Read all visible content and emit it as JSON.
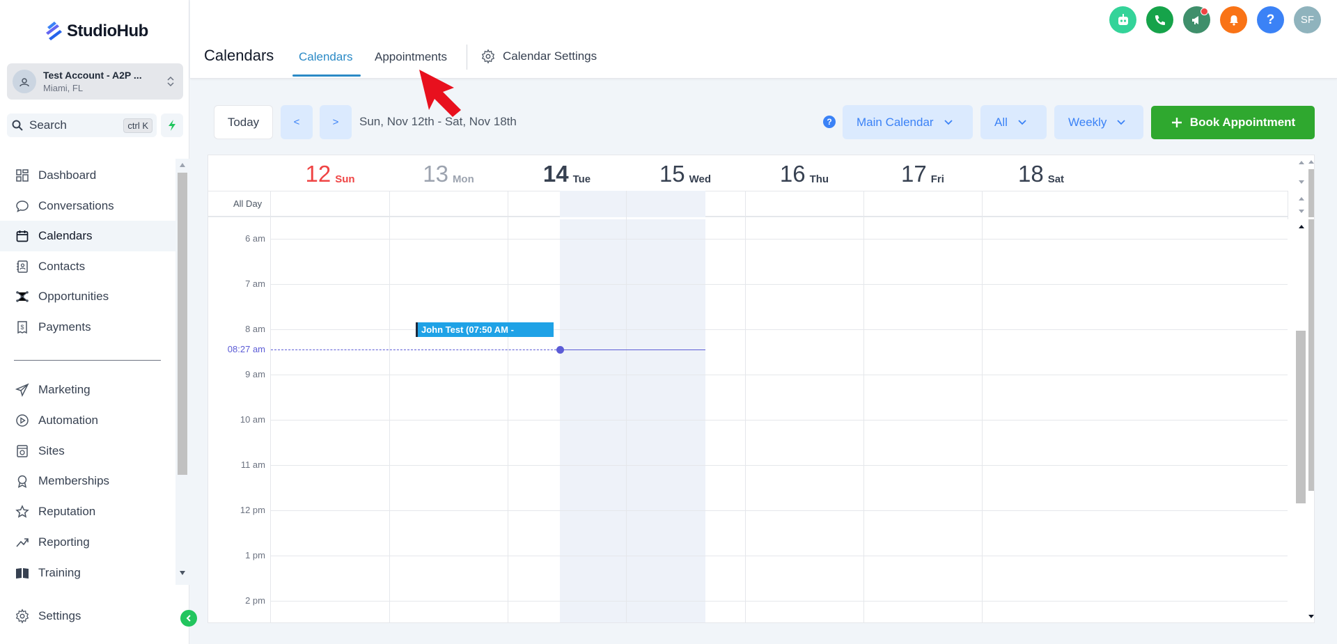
{
  "brand": {
    "name": "StudioHub",
    "accent": "#2b8ac6"
  },
  "account": {
    "name": "Test Account - A2P ...",
    "location": "Miami, FL"
  },
  "search": {
    "label": "Search",
    "shortcut": "ctrl K"
  },
  "sidebar": {
    "items": [
      {
        "label": "Dashboard",
        "icon": "dashboard-icon"
      },
      {
        "label": "Conversations",
        "icon": "chat-icon"
      },
      {
        "label": "Calendars",
        "icon": "calendar-icon",
        "active": true
      },
      {
        "label": "Contacts",
        "icon": "contacts-icon"
      },
      {
        "label": "Opportunities",
        "icon": "opportunities-icon"
      },
      {
        "label": "Payments",
        "icon": "payments-icon"
      },
      {
        "label": "Marketing",
        "icon": "send-icon"
      },
      {
        "label": "Automation",
        "icon": "automation-icon"
      },
      {
        "label": "Sites",
        "icon": "sites-icon"
      },
      {
        "label": "Memberships",
        "icon": "award-icon"
      },
      {
        "label": "Reputation",
        "icon": "star-icon"
      },
      {
        "label": "Reporting",
        "icon": "trend-icon"
      },
      {
        "label": "Training",
        "icon": "book-icon"
      }
    ],
    "settings": "Settings"
  },
  "header": {
    "title": "Calendars",
    "tabs": [
      {
        "label": "Calendars",
        "active": true
      },
      {
        "label": "Appointments"
      }
    ],
    "settings_tab": "Calendar Settings",
    "avatar_initials": "SF"
  },
  "toolbar": {
    "today": "Today",
    "prev": "<",
    "next": ">",
    "date_range": "Sun, Nov 12th - Sat, Nov 18th",
    "help": "?",
    "calendar_select": "Main Calendar",
    "filter_select": "All",
    "view_select": "Weekly",
    "book_button": "Book Appointment"
  },
  "calendar": {
    "all_day": "All Day",
    "days": [
      {
        "num": "12",
        "name": "Sun",
        "state": "sun"
      },
      {
        "num": "13",
        "name": "Mon",
        "state": "mon"
      },
      {
        "num": "14",
        "name": "Tue",
        "state": "tue"
      },
      {
        "num": "15",
        "name": "Wed",
        "state": ""
      },
      {
        "num": "16",
        "name": "Thu",
        "state": ""
      },
      {
        "num": "17",
        "name": "Fri",
        "state": ""
      },
      {
        "num": "18",
        "name": "Sat",
        "state": ""
      }
    ],
    "hours": [
      "6 am",
      "7 am",
      "8 am",
      "9 am",
      "10 am",
      "11 am",
      "12 pm",
      "1 pm",
      "2 pm"
    ],
    "now_label": "08:27 am",
    "event": {
      "title": "John Test (07:50 AM -"
    }
  },
  "colors": {
    "primary_green": "#2fa82f",
    "current_time": "#5b5bd6",
    "event_blue": "#1fa2e6",
    "sunday_red": "#ef4444"
  }
}
